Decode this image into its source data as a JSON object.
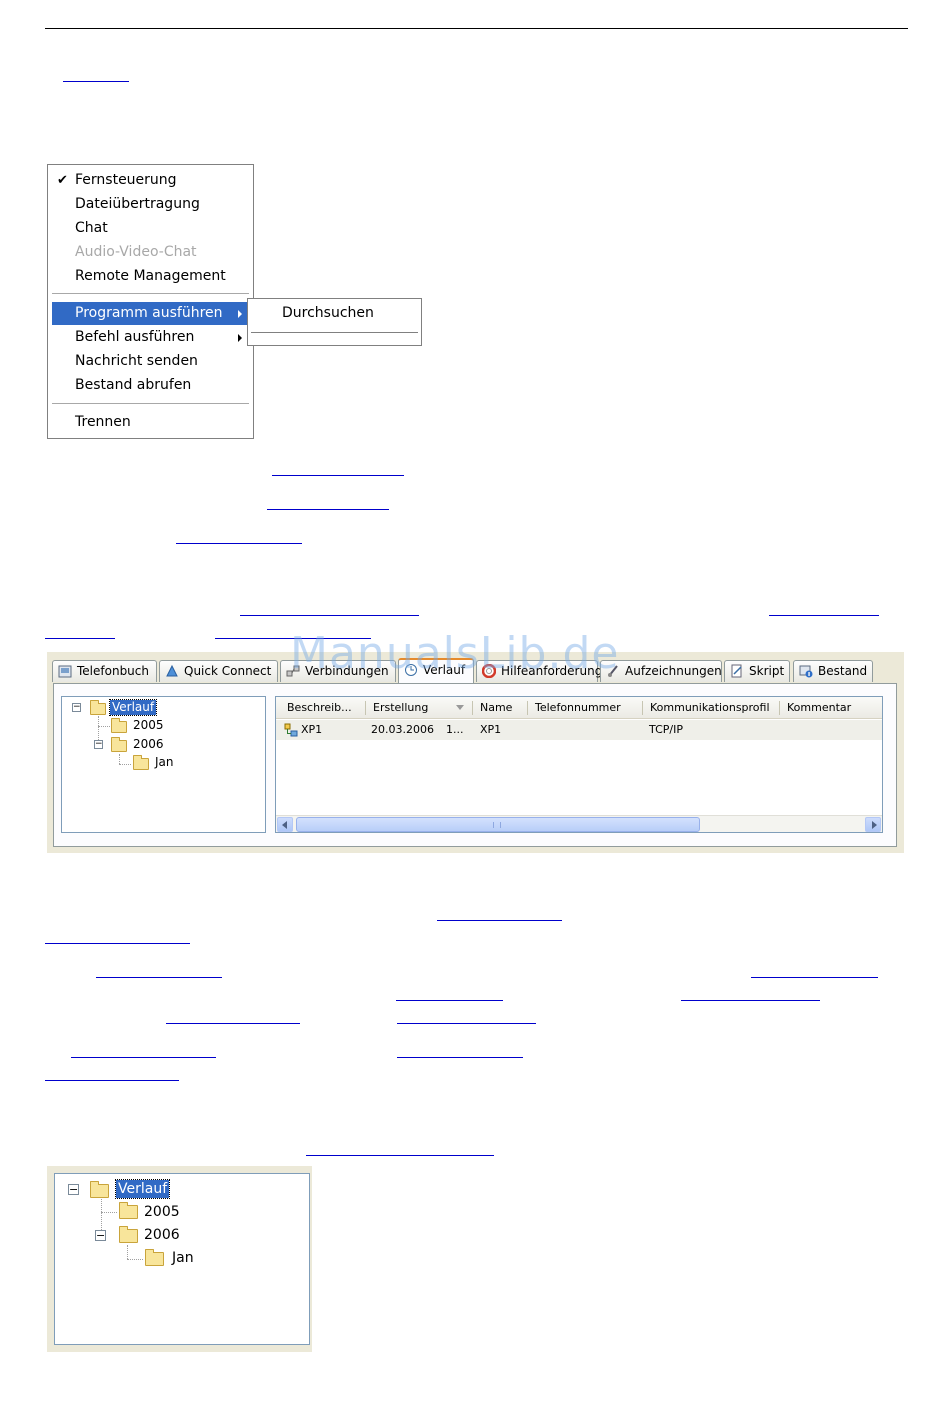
{
  "context_menu": {
    "items": [
      {
        "label": "Fernsteuerung",
        "checked": true
      },
      {
        "label": "Dateiübertragung"
      },
      {
        "label": "Chat"
      },
      {
        "label": "Audio-Video-Chat",
        "disabled": true
      },
      {
        "label": "Remote Management"
      },
      {
        "label": "Programm ausführen",
        "submenu": true,
        "active": true
      },
      {
        "label": "Befehl ausführen",
        "submenu": true
      },
      {
        "label": "Nachricht senden"
      },
      {
        "label": "Bestand abrufen"
      },
      {
        "label": "Trennen"
      }
    ],
    "check_glyph": "✔",
    "submenu": {
      "items": [
        "Durchsuchen"
      ]
    }
  },
  "watermark": "ManualsLib.de",
  "window": {
    "tabs": [
      {
        "label": "Telefonbuch",
        "icon": "phonebook-icon"
      },
      {
        "label": "Quick Connect",
        "icon": "quick-connect-icon"
      },
      {
        "label": "Verbindungen",
        "icon": "connections-icon"
      },
      {
        "label": "Verlauf",
        "icon": "history-icon",
        "selected": true
      },
      {
        "label": "Hilfeanforderung",
        "icon": "help-request-icon"
      },
      {
        "label": "Aufzeichnungen",
        "icon": "recordings-icon"
      },
      {
        "label": "Skript",
        "icon": "script-icon"
      },
      {
        "label": "Bestand",
        "icon": "inventory-icon"
      }
    ],
    "tree": {
      "root": "Verlauf",
      "children": [
        "2005",
        "2006"
      ],
      "grandchild": "Jan",
      "expand_minus": "−"
    },
    "list": {
      "columns": [
        "Beschreib...",
        "Erstellung",
        "Name",
        "Telefonnummer",
        "Kommunikationsprofil",
        "Kommentar"
      ],
      "rows": [
        {
          "beschreibung": "XP1",
          "erstellung": "20.03.2006",
          "erstellung_more": "1...",
          "name": "XP1",
          "telefonnummer": "",
          "profil": "TCP/IP",
          "kommentar": ""
        }
      ]
    }
  },
  "tree_window": {
    "root": "Verlauf",
    "children": [
      "2005",
      "2006"
    ],
    "grandchild": "Jan",
    "expand_minus": "−"
  },
  "colors": {
    "selection": "#316ac5",
    "link_underline": "#0000cc",
    "tab_highlight": "#e68b2c",
    "folder": "#f8e59b"
  }
}
